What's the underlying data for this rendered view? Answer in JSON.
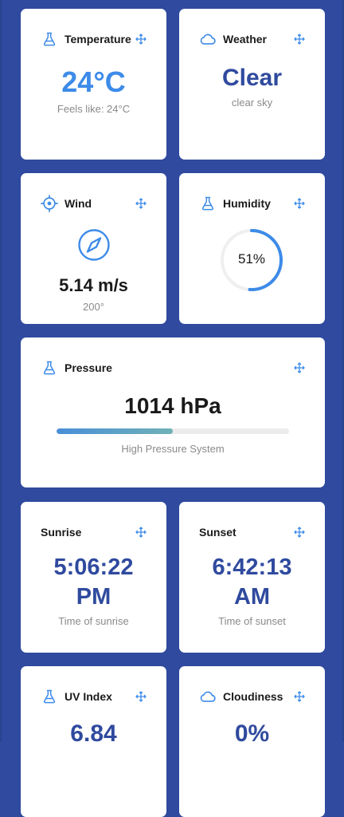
{
  "colors": {
    "background": "#2f4a9e",
    "accent_blue": "#3d8be8",
    "navy": "#2f4a9e",
    "card": "#ffffff"
  },
  "temperature": {
    "title": "Temperature",
    "icon": "flask-icon",
    "value": "24°C",
    "feels_like": "Feels like: 24°C"
  },
  "weather": {
    "title": "Weather",
    "icon": "cloud-icon",
    "value": "Clear",
    "description": "clear sky"
  },
  "wind": {
    "title": "Wind",
    "icon": "crosshair-icon",
    "direction_icon": "compass-icon",
    "speed": "5.14 m/s",
    "direction": "200°"
  },
  "humidity": {
    "title": "Humidity",
    "icon": "flask-icon",
    "value_label": "51%",
    "value_fraction": 0.51
  },
  "pressure": {
    "title": "Pressure",
    "icon": "flask-icon",
    "value": "1014 hPa",
    "level_fraction": 0.5,
    "description": "High Pressure System"
  },
  "sunrise": {
    "title": "Sunrise",
    "time_line1": "5:06:22",
    "time_line2": "PM",
    "caption": "Time of sunrise"
  },
  "sunset": {
    "title": "Sunset",
    "time_line1": "6:42:13",
    "time_line2": "AM",
    "caption": "Time of sunset"
  },
  "uv_index": {
    "title": "UV Index",
    "icon": "flask-icon",
    "value": "6.84"
  },
  "cloudiness": {
    "title": "Cloudiness",
    "icon": "cloud-icon",
    "value": "0%"
  },
  "drag_handle_icon": "move-icon"
}
